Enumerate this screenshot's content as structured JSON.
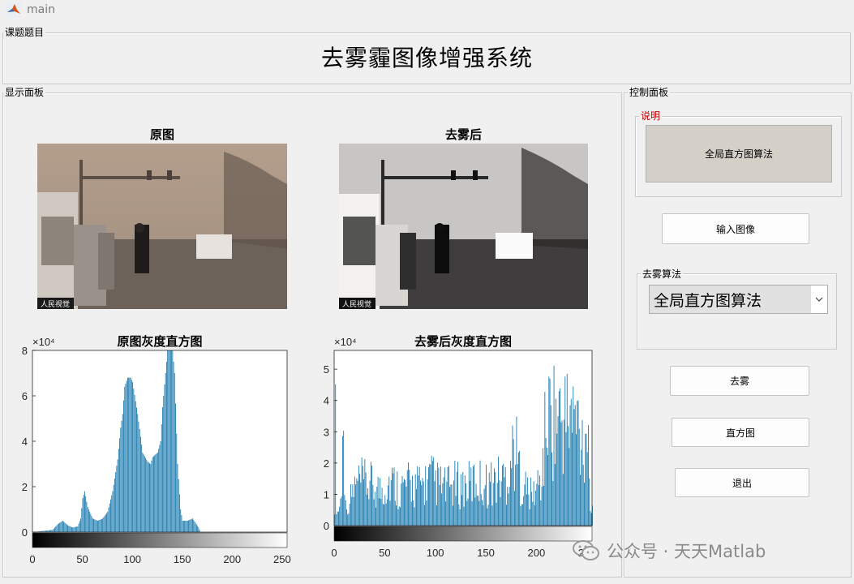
{
  "window": {
    "title": "main"
  },
  "header_panel": {
    "label": "课题题目",
    "title": "去雾霾图像增强系统"
  },
  "display_panel": {
    "label": "显示面板",
    "original": {
      "title": "原图",
      "caption": "人民视觉"
    },
    "dehazed": {
      "title": "去雾后",
      "caption": "人民视觉"
    },
    "hist_original": {
      "title": "原图灰度直方图",
      "exponent_label": "×10⁴",
      "x_ticks": [
        "0",
        "50",
        "100",
        "150",
        "200",
        "250"
      ],
      "y_ticks": [
        "0",
        "2",
        "4",
        "6",
        "8"
      ]
    },
    "hist_dehazed": {
      "title": "去雾后灰度直方图",
      "exponent_label": "×10⁴",
      "x_ticks": [
        "0",
        "50",
        "100",
        "150",
        "200",
        "250"
      ],
      "y_ticks": [
        "0",
        "1",
        "2",
        "3",
        "4",
        "5"
      ]
    }
  },
  "control_panel": {
    "label": "控制面板",
    "description": {
      "label": "说明",
      "text": "全局直方图算法"
    },
    "load_button": "输入图像",
    "algorithm_group": {
      "label": "去雾算法",
      "selected": "全局直方图算法"
    },
    "dehaze_button": "去雾",
    "histogram_button": "直方图",
    "exit_button": "退出"
  },
  "watermark": {
    "text": "公众号 · 天天Matlab"
  },
  "colors": {
    "bar": "#1a7bb0",
    "accent_label": "#c00000"
  },
  "chart_data": [
    {
      "type": "bar",
      "title": "原图灰度直方图",
      "y_unit": "×10⁴",
      "xlim": [
        0,
        255
      ],
      "ylim": [
        0,
        8
      ],
      "profile": [
        [
          0,
          0
        ],
        [
          10,
          0.05
        ],
        [
          20,
          0.1
        ],
        [
          25,
          0.35
        ],
        [
          30,
          0.5
        ],
        [
          35,
          0.3
        ],
        [
          40,
          0.2
        ],
        [
          45,
          0.25
        ],
        [
          48,
          0.6
        ],
        [
          50,
          1.5
        ],
        [
          52,
          1.8
        ],
        [
          55,
          1.1
        ],
        [
          60,
          0.6
        ],
        [
          65,
          0.5
        ],
        [
          70,
          0.6
        ],
        [
          75,
          0.9
        ],
        [
          80,
          1.8
        ],
        [
          85,
          3.2
        ],
        [
          88,
          4.6
        ],
        [
          90,
          5.2
        ],
        [
          92,
          6.4
        ],
        [
          95,
          6.8
        ],
        [
          98,
          6.8
        ],
        [
          100,
          6.6
        ],
        [
          105,
          5.2
        ],
        [
          108,
          4.2
        ],
        [
          110,
          3.5
        ],
        [
          115,
          3.1
        ],
        [
          118,
          3.0
        ],
        [
          120,
          3.3
        ],
        [
          125,
          3.5
        ],
        [
          128,
          4.0
        ],
        [
          130,
          5.5
        ],
        [
          133,
          7.0
        ],
        [
          135,
          8.0
        ],
        [
          140,
          8.0
        ],
        [
          142,
          7.0
        ],
        [
          145,
          3.0
        ],
        [
          148,
          1.0
        ],
        [
          150,
          0.5
        ],
        [
          155,
          0.5
        ],
        [
          160,
          0.6
        ],
        [
          163,
          0.4
        ],
        [
          166,
          0.2
        ],
        [
          168,
          0
        ]
      ]
    },
    {
      "type": "bar",
      "title": "去雾后灰度直方图",
      "y_unit": "×10⁴",
      "xlim": [
        0,
        255
      ],
      "ylim": [
        0,
        5.6
      ],
      "profile": [
        [
          0,
          0.6
        ],
        [
          1,
          4.8
        ],
        [
          2,
          0.5
        ],
        [
          6,
          1.2
        ],
        [
          9,
          5.1
        ],
        [
          12,
          0.6
        ],
        [
          18,
          1.8
        ],
        [
          25,
          2.2
        ],
        [
          35,
          2.1
        ],
        [
          45,
          1.8
        ],
        [
          55,
          2.3
        ],
        [
          65,
          1.9
        ],
        [
          75,
          2.1
        ],
        [
          85,
          2.0
        ],
        [
          95,
          2.4
        ],
        [
          100,
          2.2
        ],
        [
          110,
          1.9
        ],
        [
          120,
          2.1
        ],
        [
          130,
          2.0
        ],
        [
          140,
          2.3
        ],
        [
          150,
          2.1
        ],
        [
          160,
          2.3
        ],
        [
          170,
          2.5
        ],
        [
          178,
          4.1
        ],
        [
          185,
          2.2
        ],
        [
          195,
          1.5
        ],
        [
          205,
          2.4
        ],
        [
          207,
          3.8
        ],
        [
          210,
          5.5
        ],
        [
          218,
          5.6
        ],
        [
          225,
          5.4
        ],
        [
          232,
          5.5
        ],
        [
          240,
          5.3
        ],
        [
          246,
          4.4
        ],
        [
          250,
          5.5
        ],
        [
          254,
          0.4
        ]
      ]
    }
  ]
}
